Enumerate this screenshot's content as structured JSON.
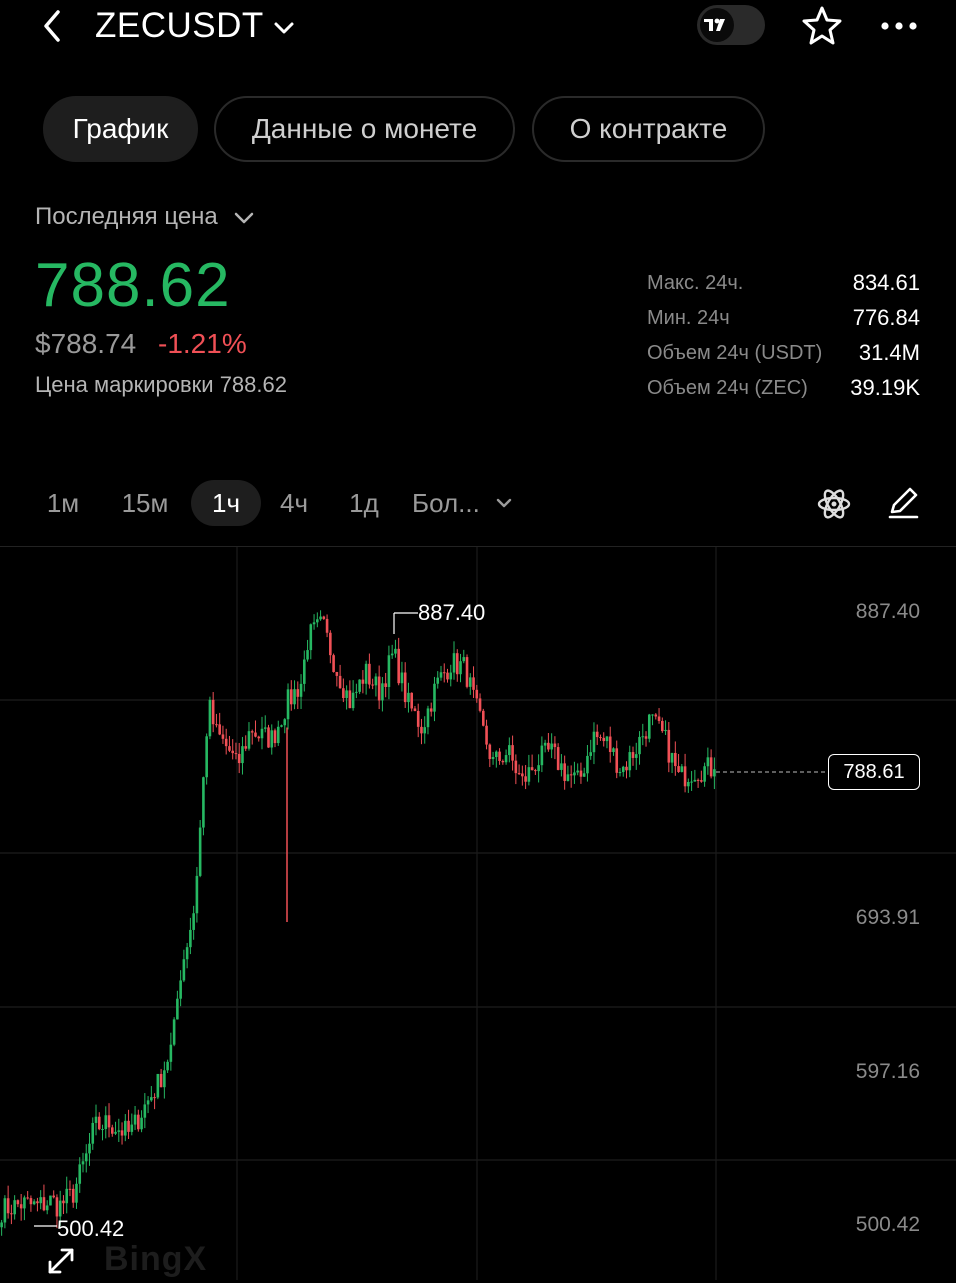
{
  "header": {
    "symbol": "ZECUSDT",
    "icons": [
      "back-chevron-icon",
      "dropdown-chevron-icon",
      "tradingview-toggle-icon",
      "star-icon",
      "more-icon"
    ]
  },
  "tabs": [
    {
      "label": "График",
      "active": true
    },
    {
      "label": "Данные о монете",
      "active": false
    },
    {
      "label": "О контракте",
      "active": false
    }
  ],
  "price": {
    "label": "Последняя цена",
    "last": "788.62",
    "usd": "$788.74",
    "change": "-1.21%",
    "mark_label": "Цена маркировки 788.62"
  },
  "stats": [
    {
      "label": "Макс. 24ч.",
      "value": "834.61"
    },
    {
      "label": "Мин. 24ч",
      "value": "776.84"
    },
    {
      "label": "Объем 24ч (USDT)",
      "value": "31.4M"
    },
    {
      "label": "Объем 24ч (ZEC)",
      "value": "39.19K"
    }
  ],
  "timeframes": [
    {
      "label": "1м",
      "active": false
    },
    {
      "label": "15м",
      "active": false
    },
    {
      "label": "1ч",
      "active": true
    },
    {
      "label": "4ч",
      "active": false
    },
    {
      "label": "1д",
      "active": false
    },
    {
      "label": "Бол...",
      "active": false
    }
  ],
  "colors": {
    "up": "#26b862",
    "down": "#f05056",
    "bg": "#000000",
    "grid": "#1c1c1c"
  },
  "chart_data": {
    "type": "candlestick",
    "y_tick_labels": [
      "887.40",
      "693.91",
      "597.16",
      "500.42"
    ],
    "ylim": [
      500.42,
      887.4
    ],
    "high_label": "887.40",
    "low_label": "500.42",
    "current_price_label": "788.61",
    "watermark": "BingX",
    "close_path": [
      [
        0,
        510
      ],
      [
        3,
        514
      ],
      [
        5,
        512
      ],
      [
        7,
        516
      ],
      [
        8,
        512
      ],
      [
        10,
        520
      ],
      [
        12,
        545
      ],
      [
        13,
        562
      ],
      [
        15,
        565
      ],
      [
        17,
        560
      ],
      [
        18,
        558
      ],
      [
        20,
        575
      ],
      [
        22,
        590
      ],
      [
        24,
        615
      ],
      [
        25,
        658
      ],
      [
        27,
        700
      ],
      [
        28,
        760
      ],
      [
        29,
        830
      ],
      [
        30,
        812
      ],
      [
        32,
        800
      ],
      [
        33,
        790
      ],
      [
        35,
        815
      ],
      [
        36,
        810
      ],
      [
        38,
        808
      ],
      [
        40,
        830
      ],
      [
        42,
        843
      ],
      [
        43,
        872
      ],
      [
        45,
        880
      ],
      [
        47,
        852
      ],
      [
        49,
        830
      ],
      [
        51,
        850
      ],
      [
        53,
        838
      ],
      [
        55,
        862
      ],
      [
        57,
        830
      ],
      [
        59,
        815
      ],
      [
        61,
        842
      ],
      [
        63,
        856
      ],
      [
        65,
        853
      ],
      [
        67,
        820
      ],
      [
        69,
        792
      ],
      [
        71,
        800
      ],
      [
        73,
        780
      ],
      [
        75,
        793
      ],
      [
        77,
        800
      ],
      [
        79,
        787
      ],
      [
        81,
        780
      ],
      [
        83,
        810
      ],
      [
        85,
        805
      ],
      [
        87,
        788
      ],
      [
        89,
        802
      ],
      [
        91,
        820
      ],
      [
        93,
        808
      ],
      [
        95,
        783
      ],
      [
        97,
        788
      ],
      [
        99,
        789
      ]
    ]
  }
}
